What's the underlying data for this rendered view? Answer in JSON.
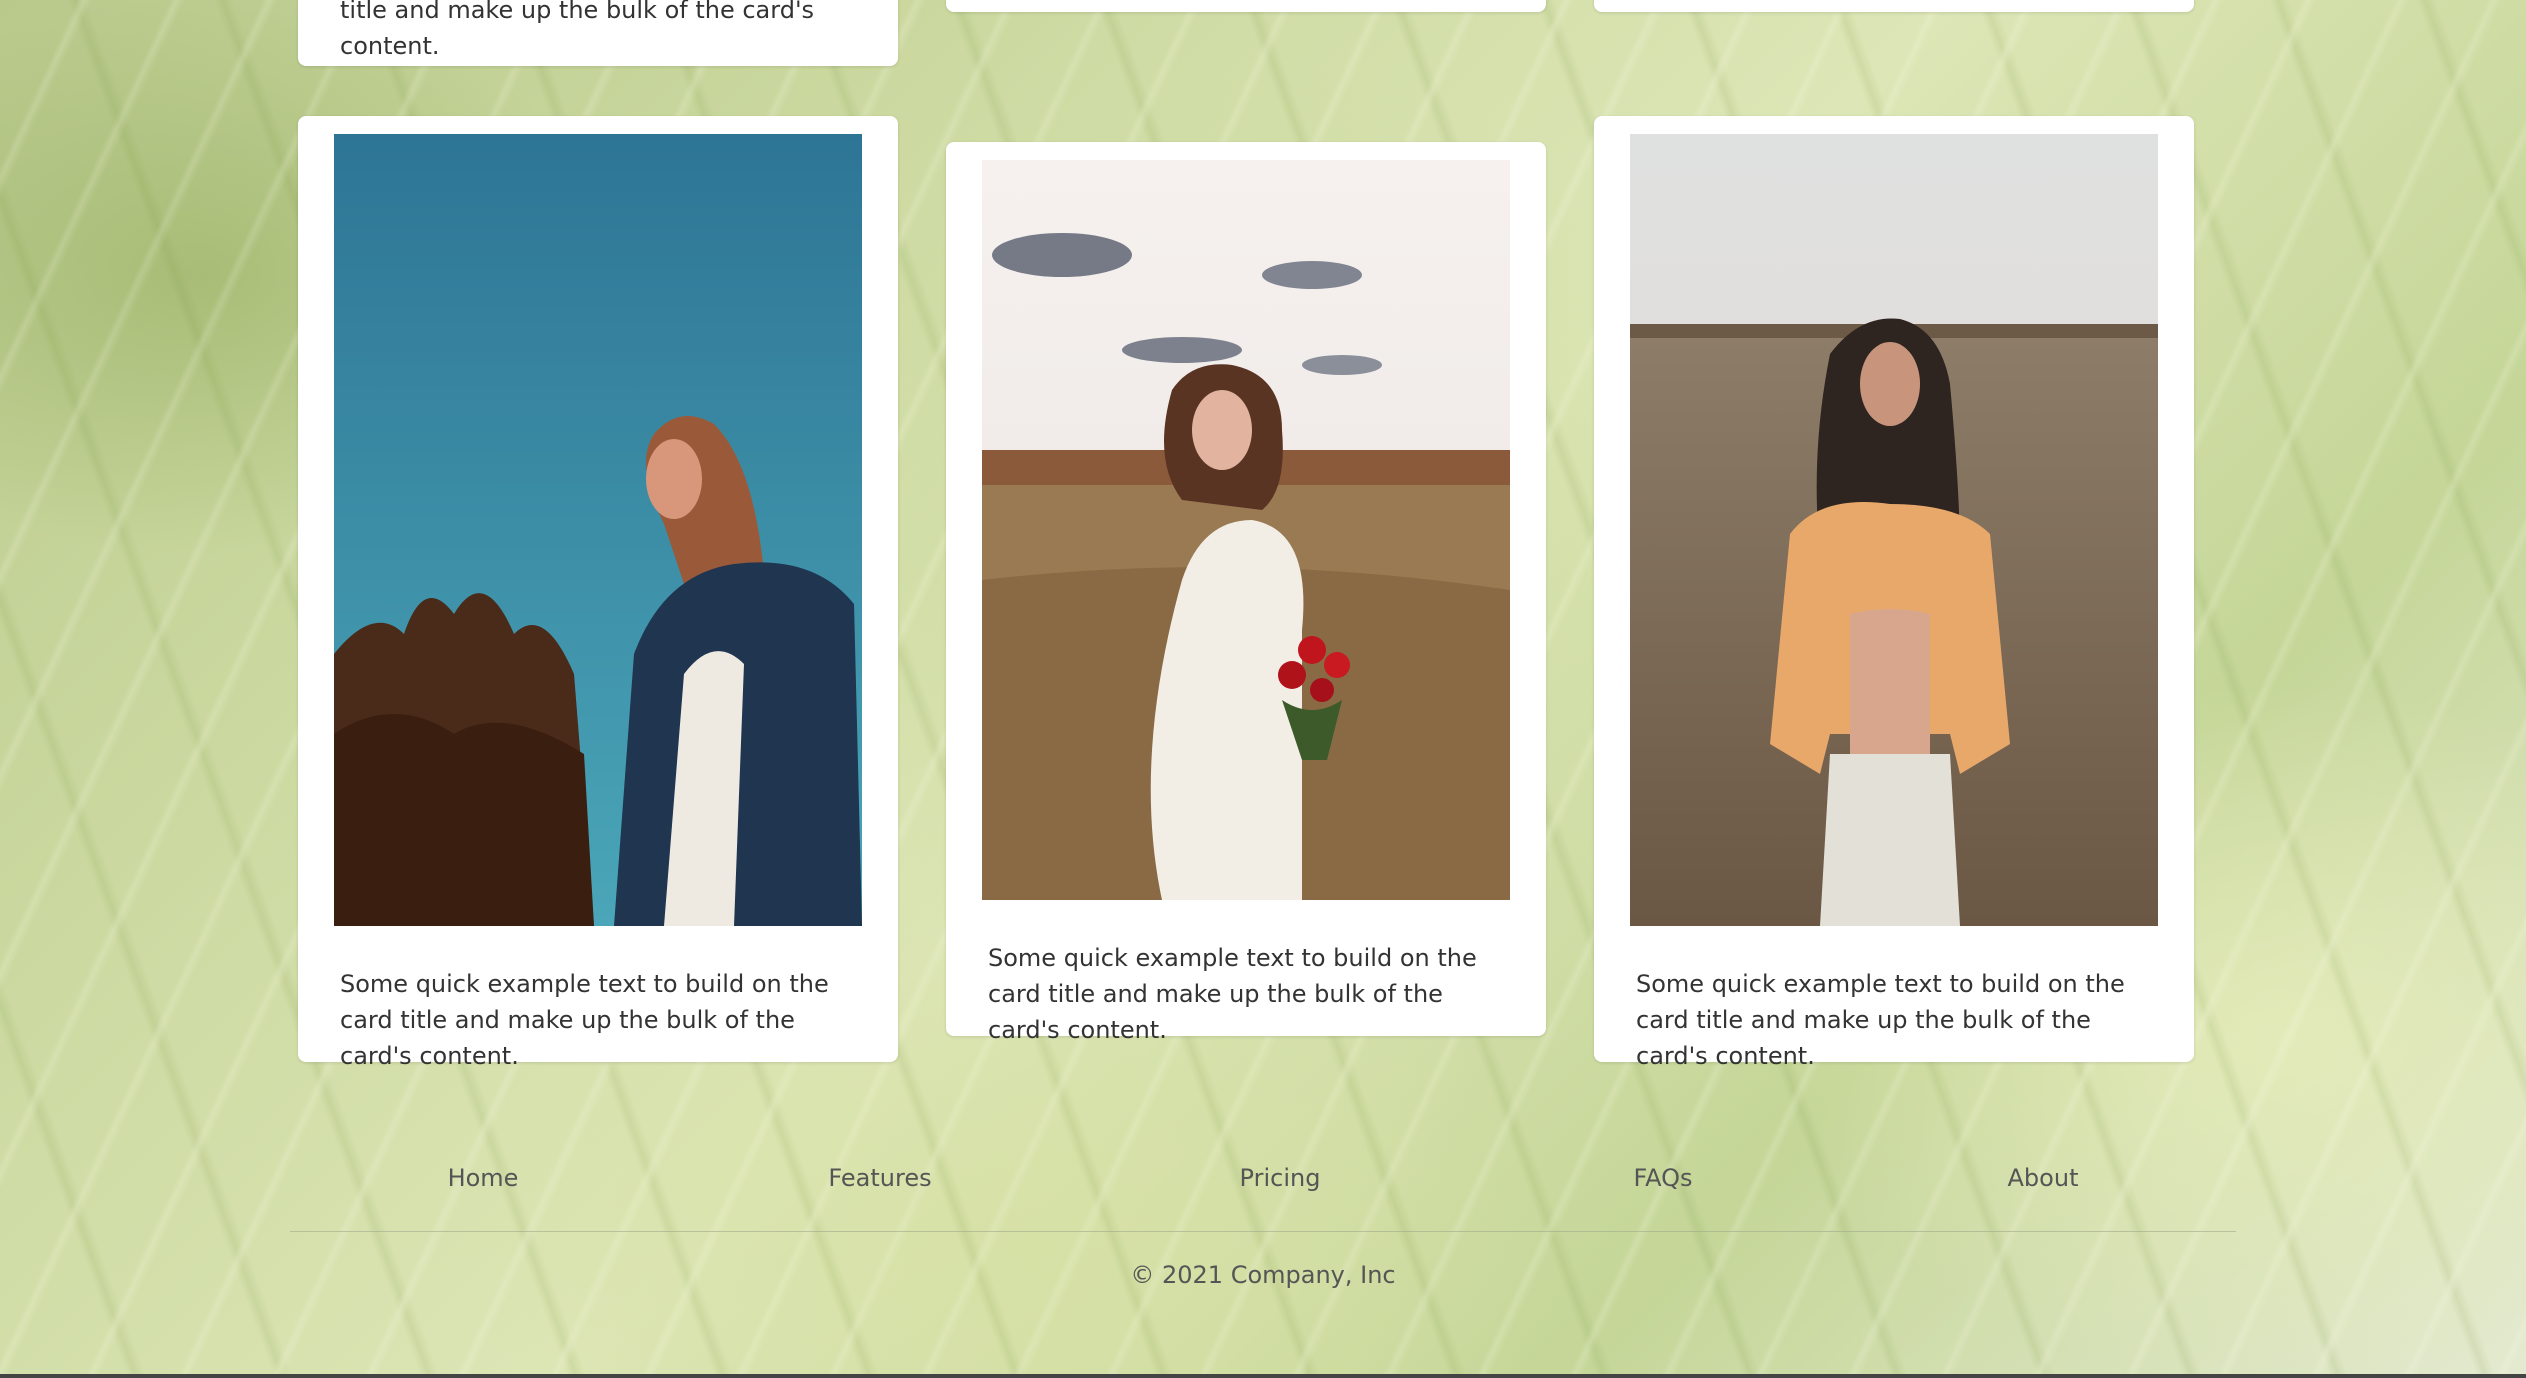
{
  "cards": {
    "top": {
      "text": "title and make up the bulk of the card's content."
    },
    "items": [
      {
        "photo_alt": "Woman with eyes closed in denim jacket against blue sky",
        "text": "Some quick example text to build on the card title and make up the bulk of the card's content."
      },
      {
        "photo_alt": "Woman holding red roses in a field",
        "text": "Some quick example text to build on the card title and make up the bulk of the card's content."
      },
      {
        "photo_alt": "Woman in floral top standing in tall grass",
        "text": "Some quick example text to build on the card title and make up the bulk of the card's content."
      }
    ]
  },
  "footer": {
    "nav": [
      "Home",
      "Features",
      "Pricing",
      "FAQs",
      "About"
    ],
    "copyright": "© 2021 Company, Inc"
  },
  "colors": {
    "card_bg": "#ffffff",
    "text": "#333333",
    "footer_text": "#555555"
  }
}
